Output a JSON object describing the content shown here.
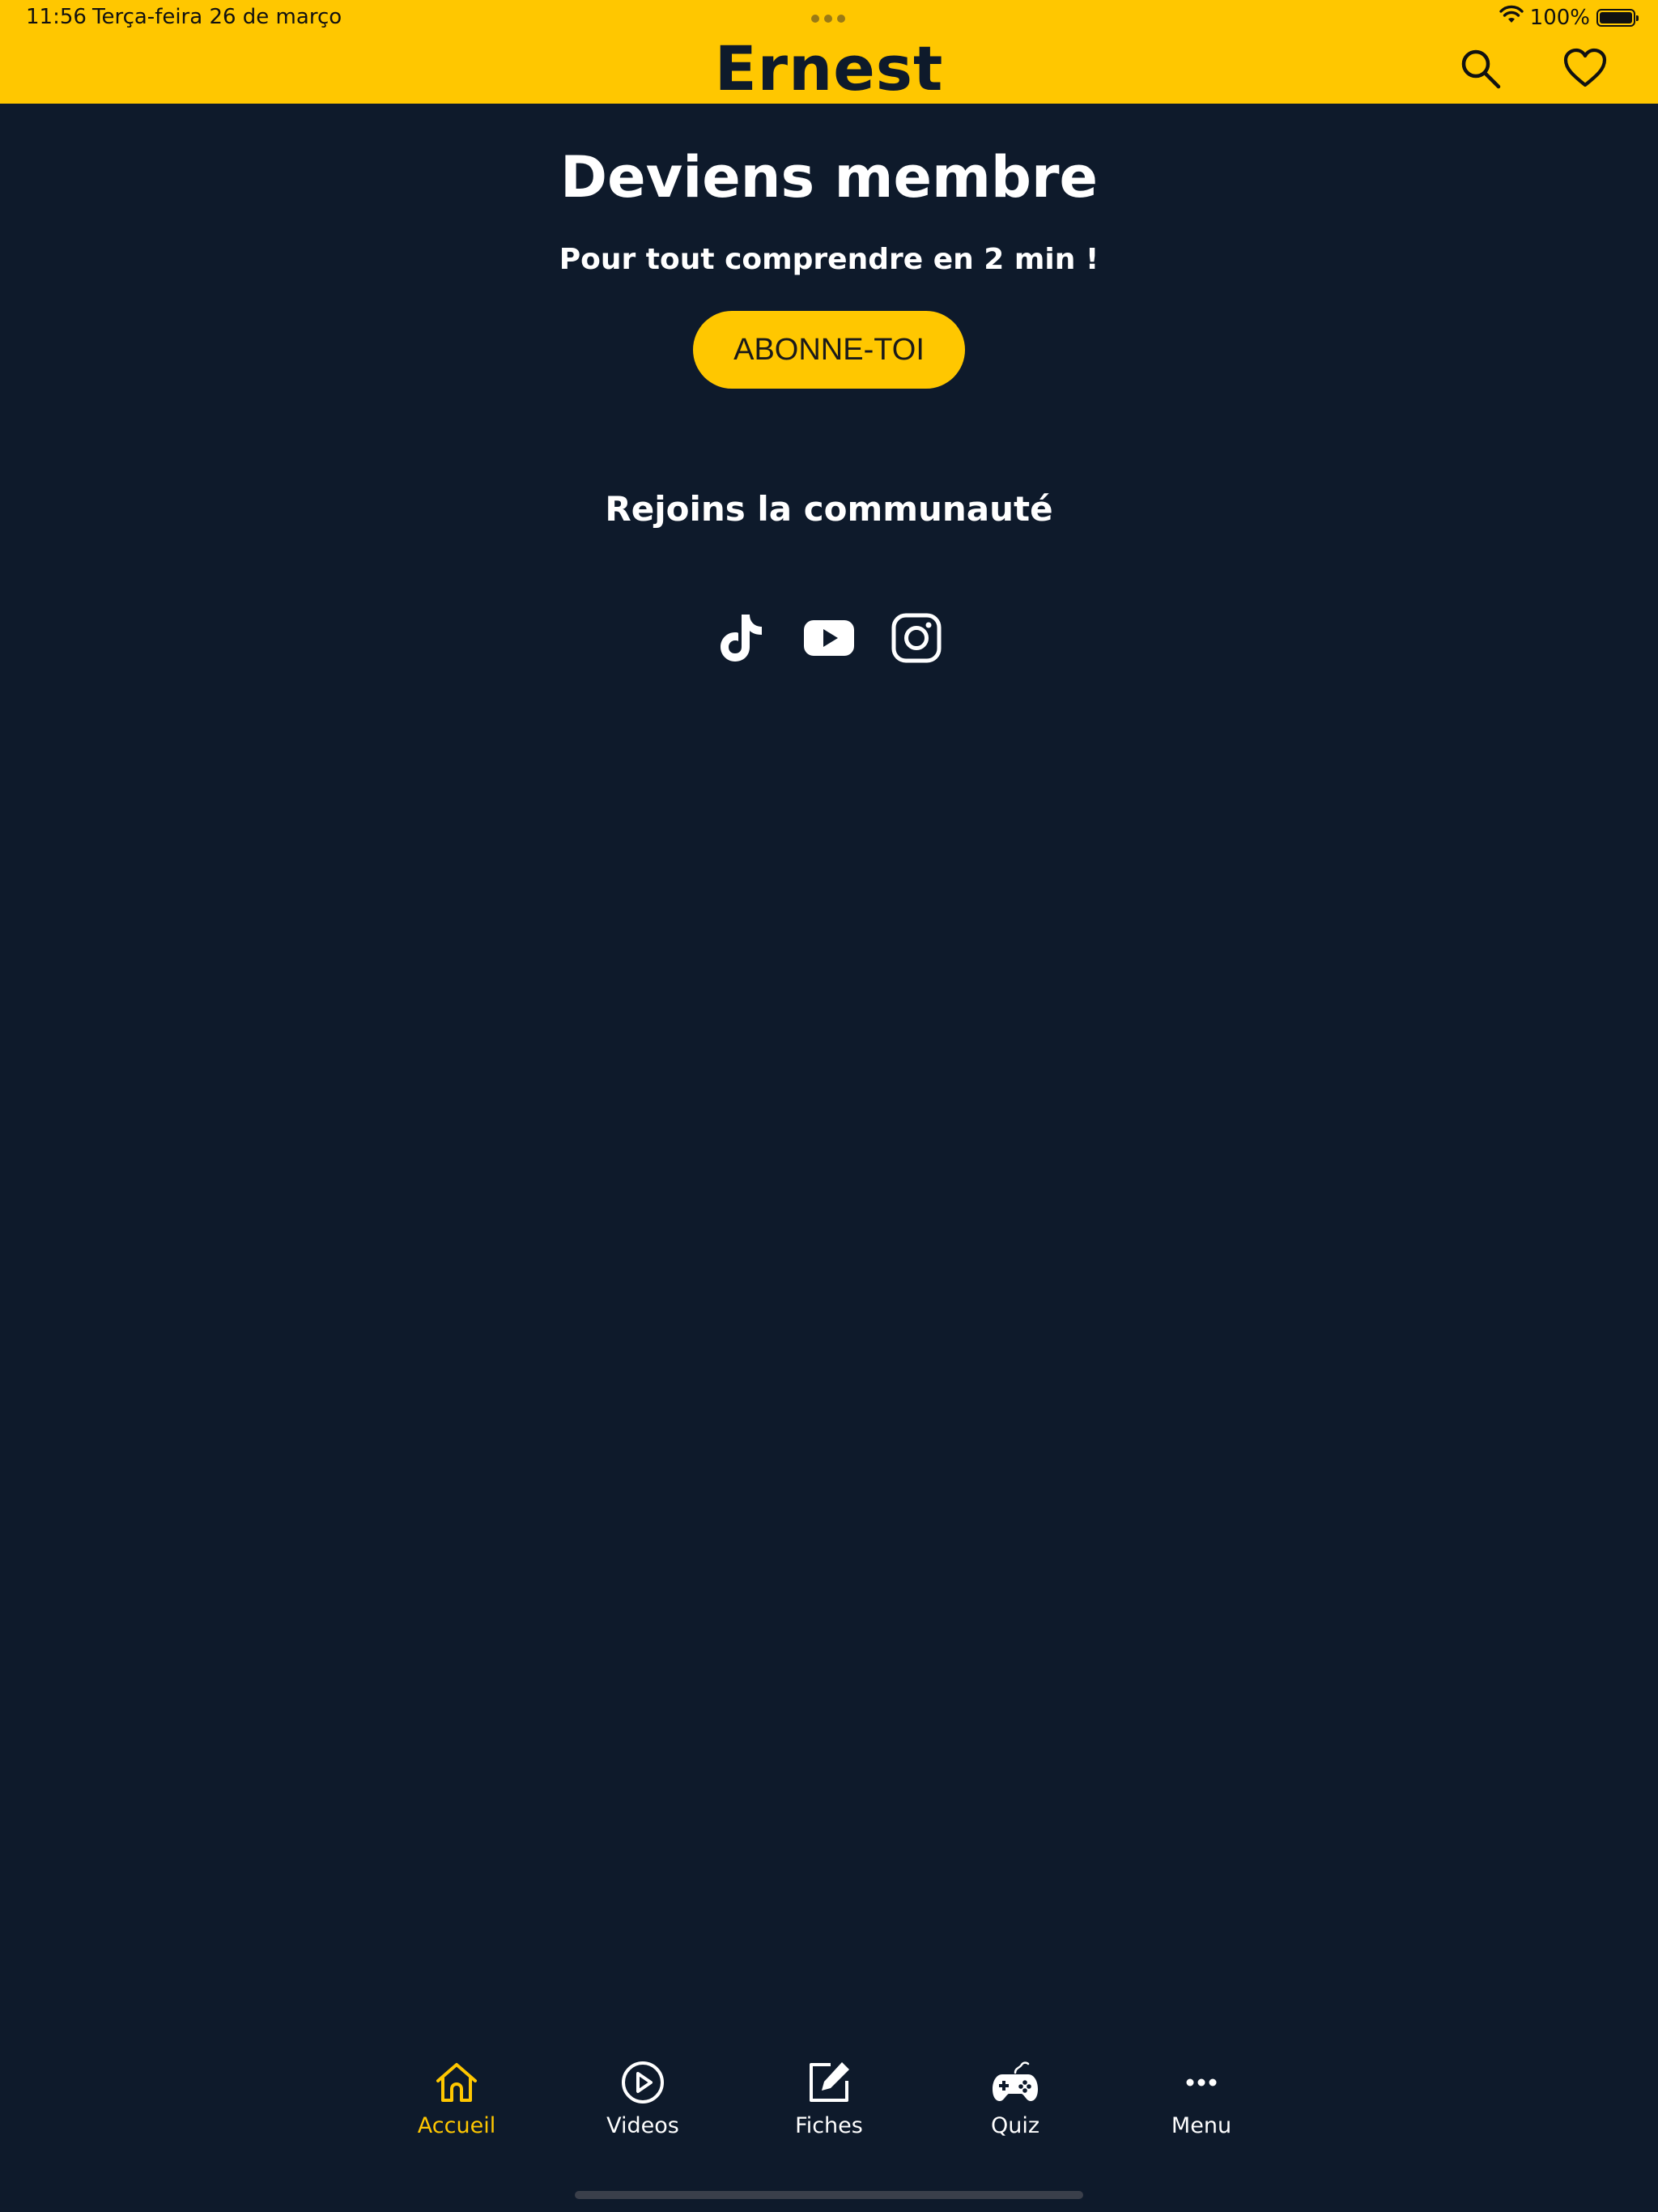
{
  "status_bar": {
    "time": "11:56",
    "date": "Terça-feira 26 de março",
    "battery_text": "100%",
    "battery_level": 1.0
  },
  "header": {
    "brand": "Ernest",
    "search_icon": "search-icon",
    "favorite_icon": "heart-icon",
    "background_color": "#ffc700"
  },
  "main": {
    "title": "Deviens membre",
    "subtitle": "Pour tout comprendre en 2 min !",
    "cta_label": "ABONNE-TOI",
    "community_title": "Rejoins la communauté",
    "socials": [
      "tiktok-icon",
      "youtube-icon",
      "instagram-icon"
    ],
    "background_color": "#0e1a2b",
    "accent_color": "#ffc700"
  },
  "tabbar": {
    "items": [
      {
        "label": "Accueil",
        "icon": "home-icon",
        "active": true
      },
      {
        "label": "Videos",
        "icon": "play-circle-icon",
        "active": false
      },
      {
        "label": "Fiches",
        "icon": "edit-note-icon",
        "active": false
      },
      {
        "label": "Quiz",
        "icon": "gamepad-icon",
        "active": false
      },
      {
        "label": "Menu",
        "icon": "more-dots-icon",
        "active": false
      }
    ]
  }
}
